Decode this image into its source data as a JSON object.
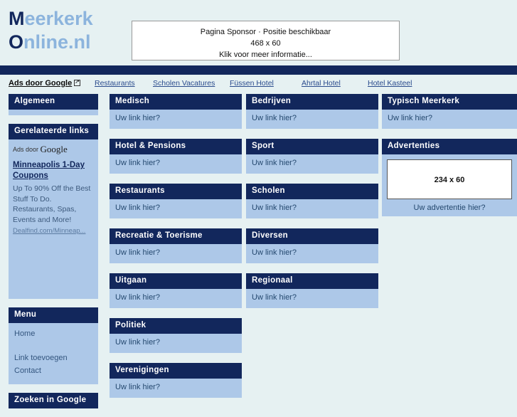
{
  "site": {
    "logo_line1_cap": "M",
    "logo_line1_rest": "eerkerk",
    "logo_line2_cap": "O",
    "logo_line2_rest": "nline.nl",
    "accent_navy": "#12275c",
    "accent_light_blue": "#adc8e8",
    "page_bg": "#e6f1f2"
  },
  "sponsor": {
    "line1": "Pagina Sponsor · Positie beschikbaar",
    "line2": "468 x 60",
    "line3": "Klik voor meer informatie..."
  },
  "adsbar": {
    "label": "Ads door Google",
    "links": [
      {
        "label": "Restaurants"
      },
      {
        "label": "Scholen Vacatures"
      },
      {
        "label": "Füssen Hotel"
      },
      {
        "label": "Ahrtal Hotel"
      },
      {
        "label": "Hotel Kasteel"
      }
    ]
  },
  "sidebar": {
    "algemeen": {
      "title": "Algemeen"
    },
    "gerelateerde": {
      "title": "Gerelateerde links",
      "ads_by": "Ads door ",
      "ads_by_brand": "Google",
      "ad_title": "Minneapolis 1-Day Coupons",
      "ad_desc": "Up To 90% Off the Best Stuff To Do. Restaurants, Spas, Events and More!",
      "ad_url": "Dealfind.com/Minneap..."
    },
    "menu": {
      "title": "Menu",
      "items": [
        {
          "label": "Home"
        },
        {
          "label": "Link toevoegen"
        },
        {
          "label": "Contact"
        }
      ]
    },
    "zoeken": {
      "title": "Zoeken in Google"
    }
  },
  "content": {
    "link_placeholder": "Uw link hier?",
    "col1": [
      {
        "title": "Medisch"
      },
      {
        "title": "Hotel & Pensions"
      },
      {
        "title": "Restaurants"
      },
      {
        "title": "Recreatie & Toerisme"
      },
      {
        "title": "Uitgaan"
      },
      {
        "title": "Politiek"
      },
      {
        "title": "Verenigingen"
      }
    ],
    "col2": [
      {
        "title": "Bedrijven"
      },
      {
        "title": "Sport"
      },
      {
        "title": "Scholen"
      },
      {
        "title": "Diversen"
      },
      {
        "title": "Regionaal"
      }
    ],
    "col3": [
      {
        "title": "Typisch Meerkerk"
      }
    ],
    "advertenties": {
      "title": "Advertenties",
      "box_label": "234 x 60",
      "caption": "Uw advertentie hier?"
    }
  }
}
